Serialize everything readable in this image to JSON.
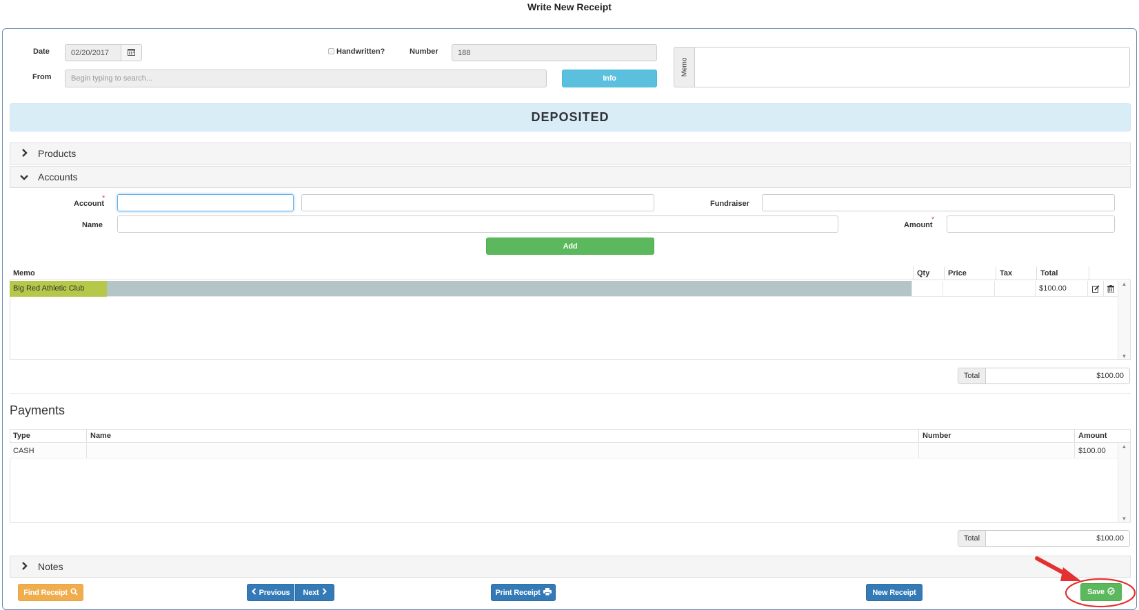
{
  "window": {
    "title": "Write New Receipt"
  },
  "header": {
    "date_label": "Date",
    "date_value": "02/20/2017",
    "handwritten_label": "Handwritten?",
    "number_label": "Number",
    "number_value": "188",
    "from_label": "From",
    "from_placeholder": "Begin typing to search...",
    "info_button": "Info",
    "memo_label": "Memo"
  },
  "status": {
    "text": "DEPOSITED",
    "color": "#d9edf7"
  },
  "sections": {
    "products": "Products",
    "accounts": "Accounts",
    "payments": "Payments",
    "notes": "Notes"
  },
  "accounts_form": {
    "account_label": "Account",
    "fundraiser_label": "Fundraiser",
    "name_label": "Name",
    "amount_label": "Amount",
    "required_mark": "*",
    "add_button": "Add"
  },
  "accounts_table": {
    "columns": [
      "Memo",
      "Qty",
      "Price",
      "Tax",
      "Total"
    ],
    "rows": [
      {
        "memo": "Big Red Athletic Club",
        "qty": "",
        "price": "",
        "tax": "",
        "total": "$100.00"
      }
    ],
    "total_label": "Total",
    "total_value": "$100.00"
  },
  "payments_table": {
    "columns": [
      "Type",
      "Name",
      "Number",
      "Amount"
    ],
    "rows": [
      {
        "type": "CASH",
        "name": "",
        "number": "",
        "amount": "$100.00"
      }
    ],
    "total_label": "Total",
    "total_value": "$100.00"
  },
  "footer": {
    "find_receipt": "Find Receipt",
    "previous": "Previous",
    "next": "Next",
    "print_receipt": "Print Receipt",
    "new_receipt": "New Receipt",
    "save": "Save"
  },
  "colors": {
    "highlight_row": "#b4c5c8",
    "highlight_cell": "#b5c84a",
    "annotation": "#e53030"
  }
}
